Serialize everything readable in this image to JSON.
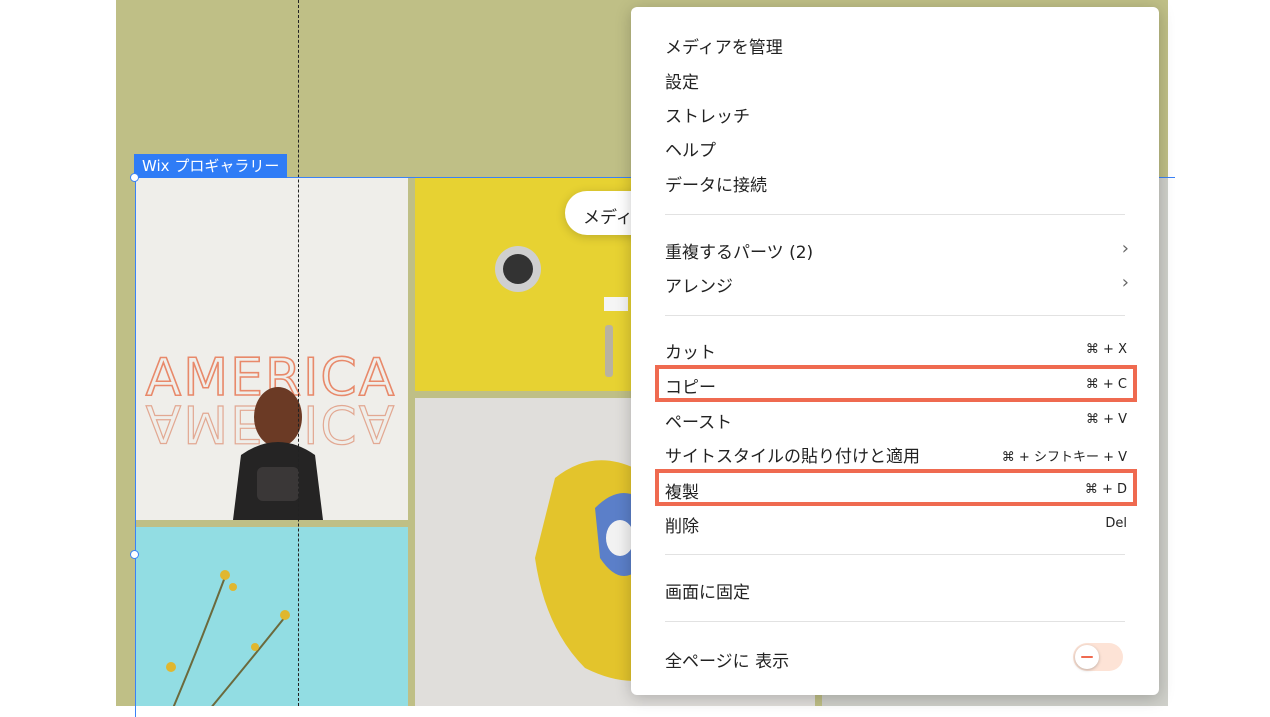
{
  "selection": {
    "label": "Wix プロギャラリー"
  },
  "toolbar": {
    "manage_media": "メディアを管理",
    "settings": "設定"
  },
  "menu": {
    "group1": [
      "メディアを管理",
      "設定",
      "ストレッチ",
      "ヘルプ",
      "データに接続"
    ],
    "overlapping": "重複するパーツ (2)",
    "arrange": "アレンジ",
    "cut": {
      "label": "カット",
      "shortcut": "⌘ + X"
    },
    "copy": {
      "label": "コピー",
      "shortcut": "⌘ + C"
    },
    "paste": {
      "label": "ペースト",
      "shortcut": "⌘ + V"
    },
    "paste_style": {
      "label": "サイトスタイルの貼り付けと適用",
      "shortcut": "⌘ + シフトキー + V"
    },
    "duplicate": {
      "label": "複製",
      "shortcut": "⌘ + D"
    },
    "delete": {
      "label": "削除",
      "shortcut": "Del"
    },
    "pin": "画面に固定",
    "show_all_pages": "全ページに 表示"
  },
  "colors": {
    "canvas": "#bfbf86",
    "highlight": "#ef6a50",
    "selection": "#2f7cf6",
    "toggle": "#fde3d6"
  }
}
